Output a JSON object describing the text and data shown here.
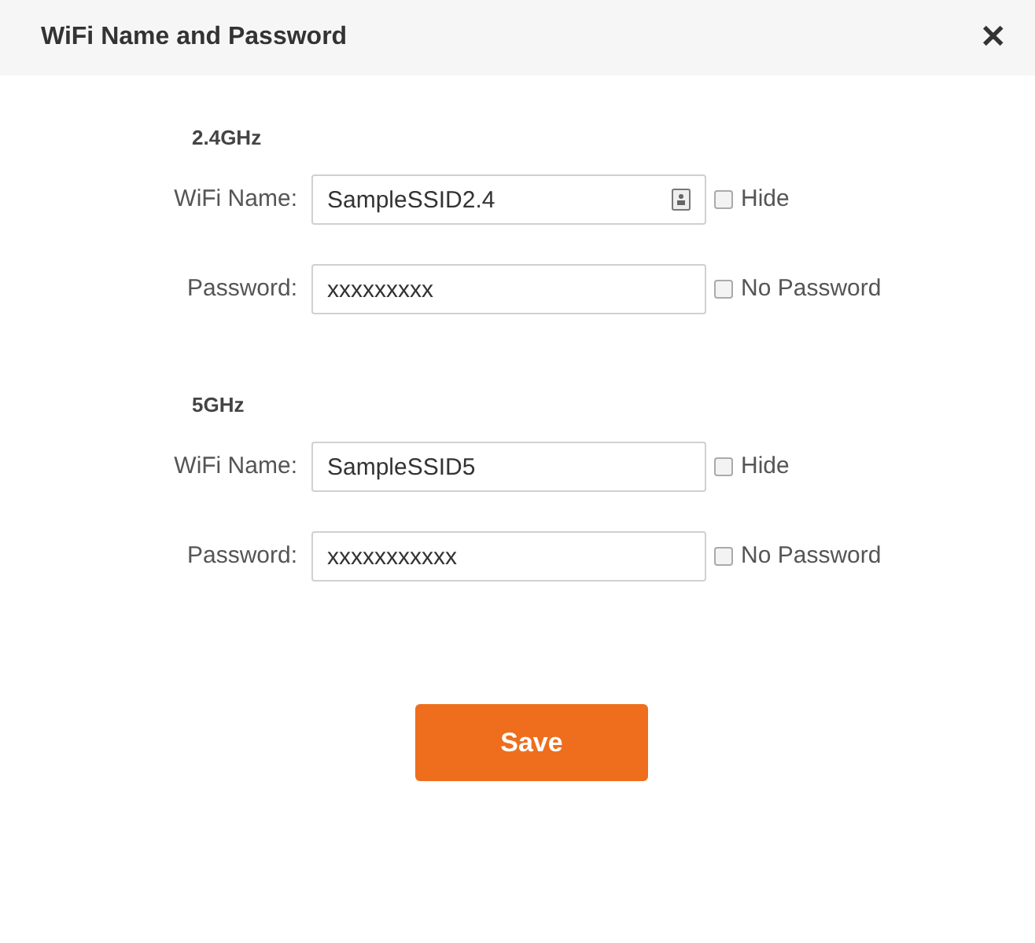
{
  "dialog": {
    "title": "WiFi Name and Password",
    "close": "✕"
  },
  "bands": [
    {
      "heading": "2.4GHz",
      "fields": [
        {
          "label": "WiFi Name:",
          "value": "SampleSSID2.4",
          "icon": true,
          "option": {
            "label": "Hide",
            "checked": false
          }
        },
        {
          "label": "Password:",
          "value": "xxxxxxxxx",
          "icon": false,
          "option": {
            "label": "No Password",
            "checked": false
          }
        }
      ]
    },
    {
      "heading": "5GHz",
      "fields": [
        {
          "label": "WiFi Name:",
          "value": "SampleSSID5",
          "icon": false,
          "option": {
            "label": "Hide",
            "checked": false
          }
        },
        {
          "label": "Password:",
          "value": "xxxxxxxxxxx",
          "icon": false,
          "option": {
            "label": "No Password",
            "checked": false
          }
        }
      ]
    }
  ],
  "save_button": "Save"
}
